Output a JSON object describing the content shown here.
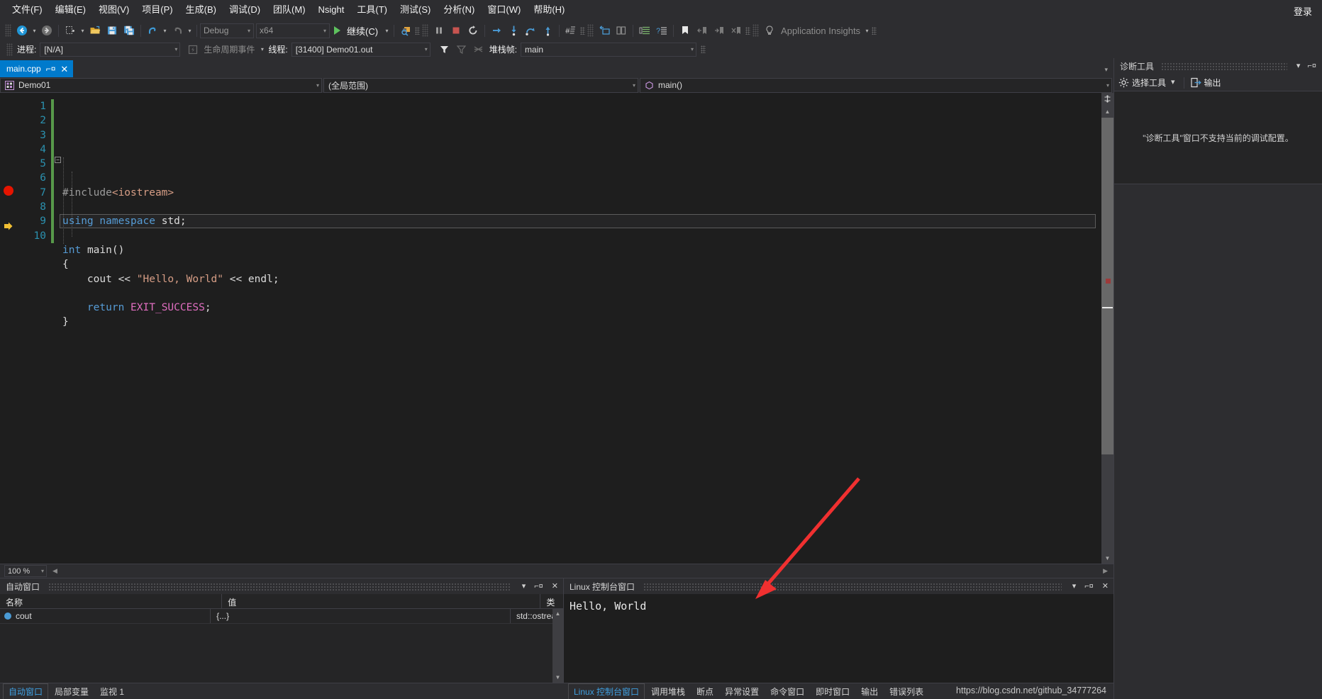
{
  "window": {
    "signin": "登录"
  },
  "menubar": {
    "items": [
      {
        "label": "文件(F)",
        "text": "文件",
        "key": "F"
      },
      {
        "label": "编辑(E)",
        "text": "编辑",
        "key": "E"
      },
      {
        "label": "视图(V)",
        "text": "视图",
        "key": "V"
      },
      {
        "label": "项目(P)",
        "text": "项目",
        "key": "P"
      },
      {
        "label": "生成(B)",
        "text": "生成",
        "key": "B"
      },
      {
        "label": "调试(D)",
        "text": "调试",
        "key": "D"
      },
      {
        "label": "团队(M)",
        "text": "团队",
        "key": "M"
      },
      {
        "label": "Nsight",
        "text": "Nsight",
        "key": "N"
      },
      {
        "label": "工具(T)",
        "text": "工具",
        "key": "T"
      },
      {
        "label": "测试(S)",
        "text": "测试",
        "key": "S"
      },
      {
        "label": "分析(N)",
        "text": "分析",
        "key": "N"
      },
      {
        "label": "窗口(W)",
        "text": "窗口",
        "key": "W"
      },
      {
        "label": "帮助(H)",
        "text": "帮助",
        "key": "H"
      }
    ]
  },
  "toolbar": {
    "config": "Debug",
    "platform": "x64",
    "continue_label": "继续(C)",
    "app_insights": "Application Insights",
    "icons": [
      "navigate-backward-icon",
      "navigate-forward-icon",
      "new-project-icon",
      "open-file-icon",
      "save-icon",
      "save-all-icon",
      "undo-icon",
      "redo-icon",
      "start-debug-icon",
      "attach-process-icon",
      "pause-icon",
      "stop-icon",
      "restart-icon",
      "show-next-statement-icon",
      "step-into-icon",
      "step-over-icon",
      "step-out-icon",
      "hex-display-icon",
      "threads-icon",
      "windows-icon",
      "comment-icon",
      "bookmark-icon",
      "prev-bookmark-icon",
      "next-bookmark-icon",
      "clear-bookmarks-icon",
      "lightbulb-icon"
    ]
  },
  "debug_context": {
    "process_label": "进程:",
    "process_value": "[N/A]",
    "lifecycle_events": "生命周期事件",
    "thread_label": "线程:",
    "thread_value": "[31400] Demo01.out",
    "stackframe_label": "堆栈帧:",
    "stackframe_value": "main"
  },
  "editor": {
    "tab": {
      "title": "main.cpp",
      "pin": "⊣",
      "close": "✕"
    },
    "nav": {
      "project": "Demo01",
      "scope": "(全局范围)",
      "function": "main()"
    },
    "lines": [
      {
        "num": "1",
        "tokens": [
          {
            "t": "#include",
            "c": "tok-pre"
          },
          {
            "t": "<iostream>",
            "c": "tok-inc"
          }
        ]
      },
      {
        "num": "2",
        "tokens": []
      },
      {
        "num": "3",
        "tokens": [
          {
            "t": "using",
            "c": "tok-kw"
          },
          {
            "t": " ",
            "c": "tok-punc"
          },
          {
            "t": "namespace",
            "c": "tok-kw"
          },
          {
            "t": " ",
            "c": "tok-punc"
          },
          {
            "t": "std",
            "c": "tok-id"
          },
          {
            "t": ";",
            "c": "tok-punc"
          }
        ]
      },
      {
        "num": "4",
        "tokens": []
      },
      {
        "num": "5",
        "tokens": [
          {
            "t": "int",
            "c": "tok-kw"
          },
          {
            "t": " ",
            "c": "tok-punc"
          },
          {
            "t": "main",
            "c": "tok-id"
          },
          {
            "t": "()",
            "c": "tok-punc"
          }
        ]
      },
      {
        "num": "6",
        "tokens": [
          {
            "t": "{",
            "c": "tok-punc"
          }
        ]
      },
      {
        "num": "7",
        "tokens": [
          {
            "t": "    ",
            "c": "tok-punc"
          },
          {
            "t": "cout",
            "c": "tok-id"
          },
          {
            "t": " << ",
            "c": "tok-punc"
          },
          {
            "t": "\"Hello, World\"",
            "c": "tok-str"
          },
          {
            "t": " << ",
            "c": "tok-punc"
          },
          {
            "t": "endl",
            "c": "tok-id"
          },
          {
            "t": ";",
            "c": "tok-punc"
          }
        ]
      },
      {
        "num": "8",
        "tokens": []
      },
      {
        "num": "9",
        "tokens": [
          {
            "t": "    ",
            "c": "tok-punc"
          },
          {
            "t": "return",
            "c": "tok-kw"
          },
          {
            "t": " ",
            "c": "tok-punc"
          },
          {
            "t": "EXIT_SUCCESS",
            "c": "tok-macro"
          },
          {
            "t": ";",
            "c": "tok-punc"
          }
        ]
      },
      {
        "num": "10",
        "tokens": [
          {
            "t": "}",
            "c": "tok-punc"
          }
        ]
      }
    ],
    "breakpoint_line": 7,
    "current_line": 9,
    "fold_line": 5,
    "zoom": "100 %"
  },
  "diagnostics": {
    "title": "诊断工具",
    "select_tools": "选择工具",
    "output": "输出",
    "message": "\"诊断工具\"窗口不支持当前的调试配置。"
  },
  "autos": {
    "title": "自动窗口",
    "columns": [
      "名称",
      "值",
      "类型"
    ],
    "rows": [
      {
        "name": "cout",
        "value": "{...}",
        "type": "std::ostream"
      }
    ]
  },
  "console": {
    "title": "Linux 控制台窗口",
    "output": "Hello, World"
  },
  "bottom_tabs": {
    "left": [
      {
        "label": "自动窗口",
        "active": true
      },
      {
        "label": "局部变量",
        "active": false
      },
      {
        "label": "监视 1",
        "active": false
      }
    ],
    "right": [
      {
        "label": "Linux 控制台窗口",
        "active": true
      },
      {
        "label": "调用堆栈",
        "active": false
      },
      {
        "label": "断点",
        "active": false
      },
      {
        "label": "异常设置",
        "active": false
      },
      {
        "label": "命令窗口",
        "active": false
      },
      {
        "label": "即时窗口",
        "active": false
      },
      {
        "label": "输出",
        "active": false
      },
      {
        "label": "错误列表",
        "active": false
      }
    ]
  },
  "watermark": "https://blog.csdn.net/github_34777264",
  "colors": {
    "accent_blue": "#007acc",
    "active_tab_text": "#3f9fe0",
    "breakpoint_red": "#e51400",
    "current_arrow_yellow": "#ffd700",
    "changed_line_green": "#57994a",
    "annotation_red": "#f03030",
    "editor_bg": "#1e1e1e",
    "chrome_bg": "#2d2d30",
    "panel_bg": "#252526"
  }
}
